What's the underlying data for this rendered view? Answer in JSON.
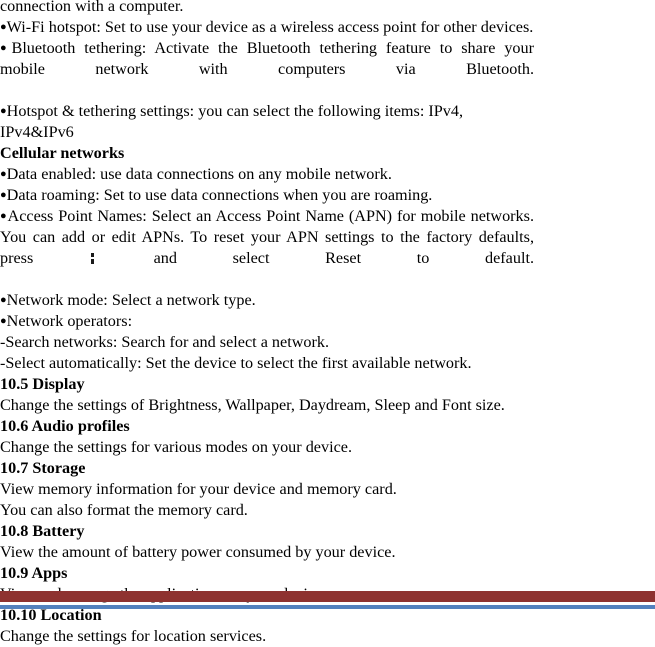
{
  "document": {
    "type": "user-manual-page",
    "body_blocks": [
      {
        "kind": "text",
        "id": "continuation",
        "text": "connection with a computer."
      },
      {
        "kind": "bullet",
        "id": "wifi-hotspot",
        "bullet": "●",
        "text": "Wi-Fi hotspot: Set to use your device as a wireless access point for other devices."
      },
      {
        "kind": "bullet-para",
        "id": "bluetooth-tethering",
        "bullet": "●",
        "text": "Bluetooth tethering: Activate the Bluetooth tethering feature to share your mobile network with computers via Bluetooth."
      },
      {
        "kind": "bullet",
        "id": "hotspot-tethering-settings",
        "bullet": "●",
        "text": "Hotspot & tethering settings: you can select the following items: IPv4, IPv4&IPv6"
      },
      {
        "kind": "heading",
        "id": "cellular-networks",
        "text": "Cellular networks"
      },
      {
        "kind": "bullet",
        "id": "data-enabled",
        "bullet": "●",
        "text": "Data enabled: use data connections on any mobile network."
      },
      {
        "kind": "bullet",
        "id": "data-roaming",
        "bullet": "●",
        "text": "Data roaming: Set to use data connections when you are roaming."
      },
      {
        "kind": "bullet-para-icon",
        "id": "access-point-names",
        "bullet": "●",
        "text_before_icon": "Access Point Names: Select an Access Point Name (APN) for mobile networks. You can add or edit APNs. To reset your APN settings to the factory defaults, press ",
        "icon": "overflow-menu-icon",
        "text_after_icon": " and select Reset to default."
      },
      {
        "kind": "bullet",
        "id": "network-mode",
        "bullet": "●",
        "text": "Network mode: Select a network type."
      },
      {
        "kind": "bullet",
        "id": "network-operators",
        "bullet": "●",
        "text": "Network operators:"
      },
      {
        "kind": "text",
        "id": "search-networks",
        "text": "-Search networks: Search for and select a network."
      },
      {
        "kind": "text",
        "id": "select-automatically",
        "text": "-Select automatically: Set the device to select the first available network."
      },
      {
        "kind": "heading",
        "id": "section-10-5",
        "text": "10.5 Display"
      },
      {
        "kind": "text",
        "id": "section-10-5-body",
        "text": "Change the settings of Brightness, Wallpaper, Daydream, Sleep and Font size."
      },
      {
        "kind": "heading",
        "id": "section-10-6",
        "text": "10.6 Audio profiles"
      },
      {
        "kind": "text",
        "id": "section-10-6-body",
        "text": "Change the settings for various modes on your device."
      },
      {
        "kind": "heading",
        "id": "section-10-7",
        "text": "10.7 Storage"
      },
      {
        "kind": "text",
        "id": "section-10-7-body-1",
        "text": "View memory information for your device and memory card."
      },
      {
        "kind": "text",
        "id": "section-10-7-body-2",
        "text": "You can also format the memory card."
      },
      {
        "kind": "heading",
        "id": "section-10-8",
        "text": "10.8 Battery"
      },
      {
        "kind": "text",
        "id": "section-10-8-body",
        "text": "View the amount of battery power consumed by your device."
      },
      {
        "kind": "heading",
        "id": "section-10-9",
        "text": "10.9 Apps"
      },
      {
        "kind": "text",
        "id": "section-10-9-body",
        "text": "View and manage the applications on your device."
      },
      {
        "kind": "heading",
        "id": "section-10-10",
        "text": "10.10 Location"
      },
      {
        "kind": "text",
        "id": "section-10-10-body",
        "text": "Change the settings for location services."
      }
    ]
  },
  "footer": {
    "rule_red_color": "#8E3230",
    "rule_blue_color": "#5281BE"
  }
}
